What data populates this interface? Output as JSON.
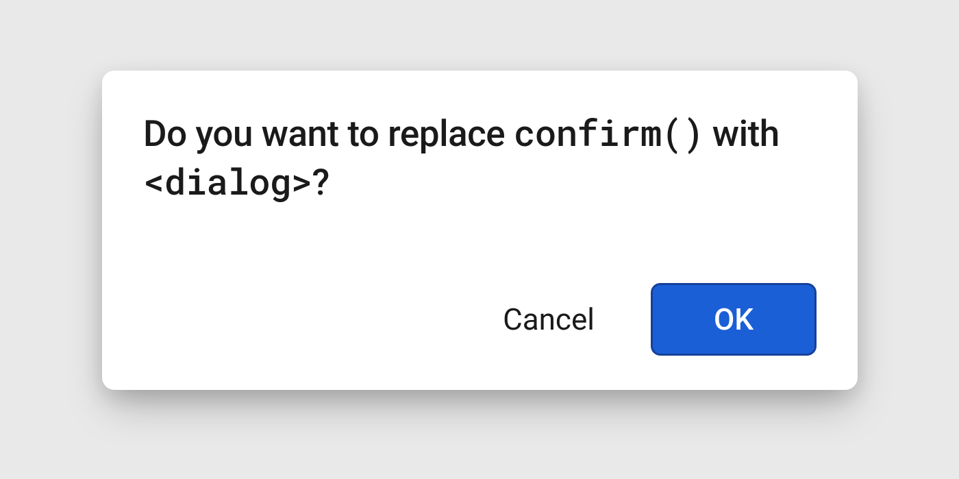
{
  "dialog": {
    "message": {
      "prefix": "Do you want to replace ",
      "code1": "confirm()",
      "middle": " with ",
      "code2": "<dialog>",
      "suffix": "?"
    },
    "actions": {
      "cancel_label": "Cancel",
      "ok_label": "OK"
    }
  },
  "colors": {
    "background": "#e9e9e9",
    "dialog_bg": "#ffffff",
    "primary": "#1a5fd6",
    "primary_border": "#16419a",
    "text": "#1a1a1a"
  }
}
